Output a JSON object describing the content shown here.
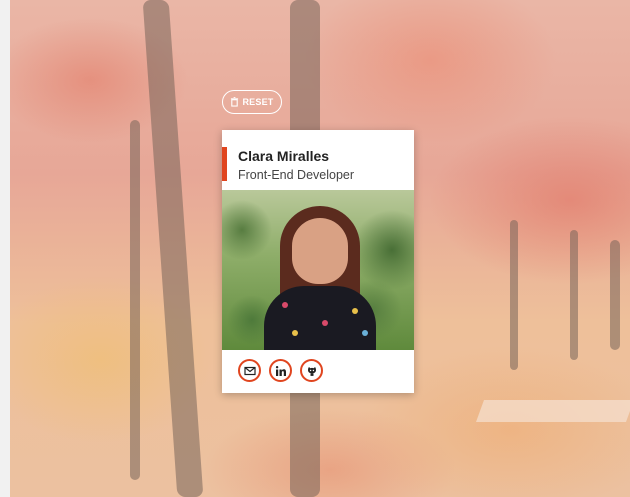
{
  "reset_button": {
    "label": "RESET",
    "icon": "trash-icon"
  },
  "profile": {
    "name": "Clara Miralles",
    "role": "Front-End Developer",
    "accent_color": "#e0451f",
    "photo_icon": "profile-photo"
  },
  "social_links": [
    {
      "name": "email",
      "icon": "envelope-icon"
    },
    {
      "name": "linkedin",
      "icon": "linkedin-icon"
    },
    {
      "name": "github",
      "icon": "github-icon"
    }
  ]
}
